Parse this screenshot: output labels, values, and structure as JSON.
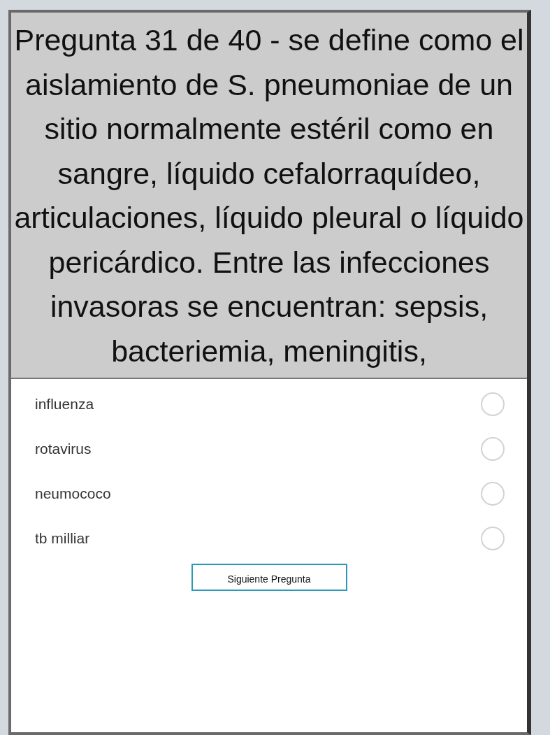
{
  "question": {
    "text": "Pregunta 31 de 40 - se define como el aislamiento de S. pneumoniae de un sitio normalmente estéril como en sangre, líquido cefalorraquídeo, articulaciones, líquido pleural o líquido pericárdico. Entre las infecciones invasoras se encuentran: sepsis, bacteriemia, meningitis,"
  },
  "options": [
    {
      "label": "influenza",
      "selected": false
    },
    {
      "label": "rotavirus",
      "selected": false
    },
    {
      "label": "neumococo",
      "selected": false
    },
    {
      "label": "tb milliar",
      "selected": false
    }
  ],
  "next_button": {
    "label": "Siguiente Pregunta"
  }
}
